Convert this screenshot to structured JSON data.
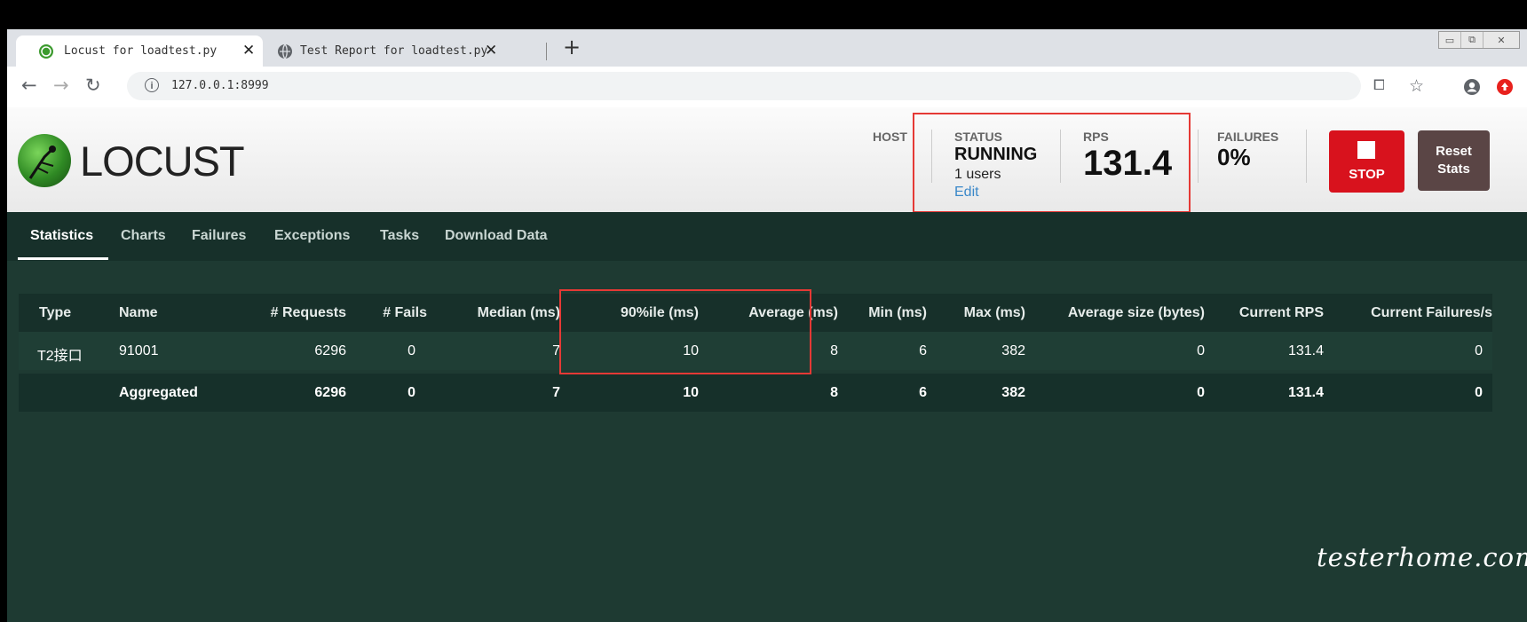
{
  "browser": {
    "tabs": [
      {
        "title": "Locust for loadtest.py",
        "active": true
      },
      {
        "title": "Test Report for loadtest.py",
        "active": false
      }
    ],
    "new_tab": "+",
    "close_glyph": "✕",
    "url": "127.0.0.1:8999"
  },
  "header": {
    "logo_text": "LOCUST",
    "host_label": "HOST",
    "status_label": "STATUS",
    "status_value": "RUNNING",
    "users_value": "1 users",
    "edit_label": "Edit",
    "rps_label": "RPS",
    "rps_value": "131.4",
    "failures_label": "FAILURES",
    "failures_value": "0%",
    "stop_label": "STOP",
    "reset_label_1": "Reset",
    "reset_label_2": "Stats",
    "stop_color": "#d8121d"
  },
  "nav": {
    "tabs": [
      "Statistics",
      "Charts",
      "Failures",
      "Exceptions",
      "Tasks",
      "Download Data"
    ],
    "active": "Statistics"
  },
  "stats": {
    "columns": [
      "Type",
      "Name",
      "# Requests",
      "# Fails",
      "Median (ms)",
      "90%ile (ms)",
      "Average (ms)",
      "Min (ms)",
      "Max (ms)",
      "Average size (bytes)",
      "Current RPS",
      "Current Failures/s"
    ],
    "rows": [
      [
        "T2接口",
        "91001",
        "6296",
        "0",
        "7",
        "10",
        "8",
        "6",
        "382",
        "0",
        "131.4",
        "0"
      ]
    ],
    "aggregated": [
      "",
      "Aggregated",
      "6296",
      "0",
      "7",
      "10",
      "8",
      "6",
      "382",
      "0",
      "131.4",
      "0"
    ]
  },
  "watermark": "testerhome.com"
}
